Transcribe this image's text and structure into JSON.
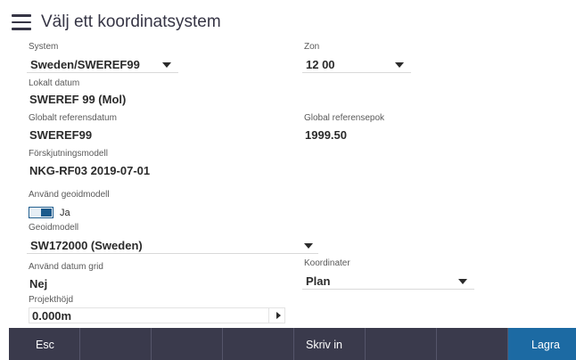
{
  "header": {
    "title": "Välj ett koordinatsystem"
  },
  "fields": {
    "system": {
      "label": "System",
      "value": "Sweden/SWEREF99"
    },
    "zon": {
      "label": "Zon",
      "value": "12 00"
    },
    "lokalt_datum": {
      "label": "Lokalt datum",
      "value": "SWEREF 99 (Mol)"
    },
    "globalt_referensdatum": {
      "label": "Globalt referensdatum",
      "value": "SWEREF99"
    },
    "global_referensepok": {
      "label": "Global referensepok",
      "value": "1999.50"
    },
    "forskjutningsmodell": {
      "label": "Förskjutningsmodell",
      "value": "NKG-RF03 2019-07-01"
    },
    "anvand_geoidmodell": {
      "label": "Använd geoidmodell",
      "toggle_label": "Ja",
      "toggle_on": true
    },
    "geoidmodell": {
      "label": "Geoidmodell",
      "value": "SW172000 (Sweden)"
    },
    "anvand_datum_grid": {
      "label": "Använd datum grid",
      "value": "Nej"
    },
    "koordinater": {
      "label": "Koordinater",
      "value": "Plan"
    },
    "projekthojd": {
      "label": "Projekthöjd",
      "value": "0.000m"
    }
  },
  "footer": {
    "buttons": [
      "Esc",
      "",
      "",
      "",
      "Skriv in",
      "",
      "",
      "Lagra"
    ]
  },
  "colors": {
    "footer_bg": "#3a3a4c",
    "primary_button": "#1c6aa3",
    "toggle_accent": "#1b5a8c"
  }
}
